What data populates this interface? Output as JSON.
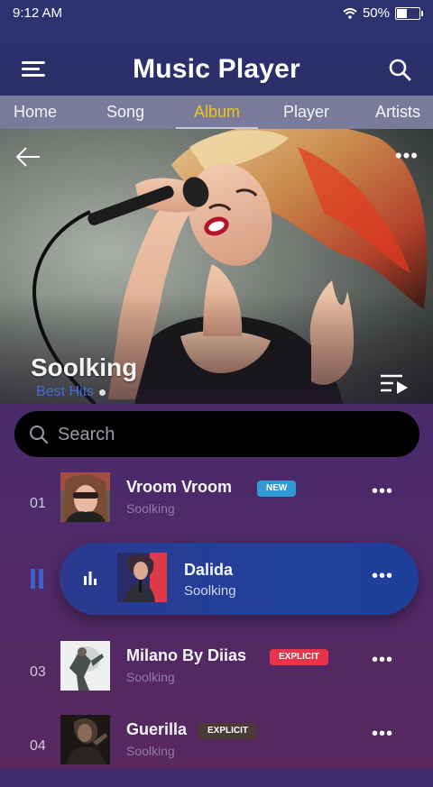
{
  "status": {
    "time": "9:12 AM",
    "battery": "50%"
  },
  "header": {
    "title": "Music Player"
  },
  "tabs": [
    {
      "label": "Home",
      "active": false
    },
    {
      "label": "Song",
      "active": false
    },
    {
      "label": "Album",
      "active": true
    },
    {
      "label": "Player",
      "active": false
    },
    {
      "label": "Artists",
      "active": false
    }
  ],
  "hero": {
    "artist": "Soolking",
    "subtitle": "Best Hits"
  },
  "search": {
    "placeholder": "Search"
  },
  "tracks": [
    {
      "num": "01",
      "title": "Vroom Vroom",
      "artist": "Soolking",
      "badge": "NEW"
    },
    {
      "num": "",
      "title": "Dalida",
      "artist": "Soolking",
      "badge": "",
      "playing": true
    },
    {
      "num": "03",
      "title": "Milano By Diias",
      "artist": "Soolking",
      "badge": "EXPLICIT"
    },
    {
      "num": "04",
      "title": "Guerilla",
      "artist": "Soolking",
      "badge": "EXPLICIT"
    }
  ],
  "icons": {
    "menu": "hamburger-icon",
    "search": "search-icon",
    "back": "back-arrow-icon",
    "more": "more-dots-icon",
    "queue": "playlist-play-icon",
    "pause": "pause-icon",
    "equalizer": "equalizer-icon"
  },
  "colors": {
    "accent": "#f0c419",
    "now_playing": "#22409a",
    "badge_new": "#2f9ad6",
    "badge_explicit": "#e8334a",
    "badge_explicit_dark": "#4a3a3a"
  }
}
